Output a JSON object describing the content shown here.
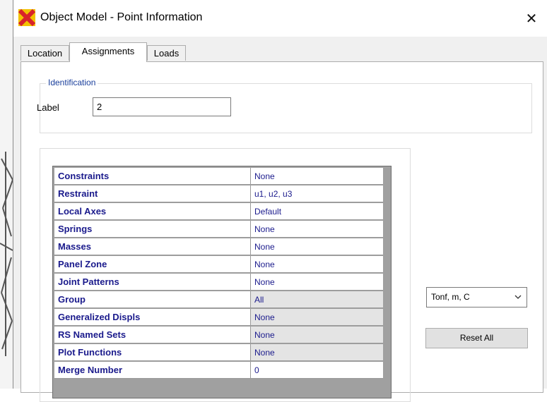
{
  "window": {
    "title": "Object Model - Point Information",
    "close_glyph": "✕"
  },
  "tabs": [
    {
      "label": "Location",
      "active": false
    },
    {
      "label": "Assignments",
      "active": true
    },
    {
      "label": "Loads",
      "active": false
    }
  ],
  "identification": {
    "legend": "Identification",
    "label_caption": "Label",
    "label_value": "2"
  },
  "assignments": [
    {
      "name": "Constraints",
      "value": "None",
      "editable": true
    },
    {
      "name": "Restraint",
      "value": "u1, u2, u3",
      "editable": true
    },
    {
      "name": "Local Axes",
      "value": "Default",
      "editable": true
    },
    {
      "name": "Springs",
      "value": "None",
      "editable": true
    },
    {
      "name": "Masses",
      "value": "None",
      "editable": true
    },
    {
      "name": "Panel Zone",
      "value": "None",
      "editable": true
    },
    {
      "name": "Joint Patterns",
      "value": "None",
      "editable": true
    },
    {
      "name": "Group",
      "value": "All",
      "editable": false
    },
    {
      "name": "Generalized Displs",
      "value": "None",
      "editable": false
    },
    {
      "name": "RS Named Sets",
      "value": "None",
      "editable": false
    },
    {
      "name": "Plot Functions",
      "value": "None",
      "editable": false
    },
    {
      "name": "Merge Number",
      "value": "0",
      "editable": true
    }
  ],
  "units": {
    "selected": "Tonf, m, C"
  },
  "reset_label": "Reset All",
  "colors": {
    "label_blue": "#1a1a8c",
    "legend_blue": "#1a3f9c",
    "readonly_cell": "#e4e4e4",
    "icon_red": "#d8232a",
    "icon_yellow": "#f2c200"
  }
}
